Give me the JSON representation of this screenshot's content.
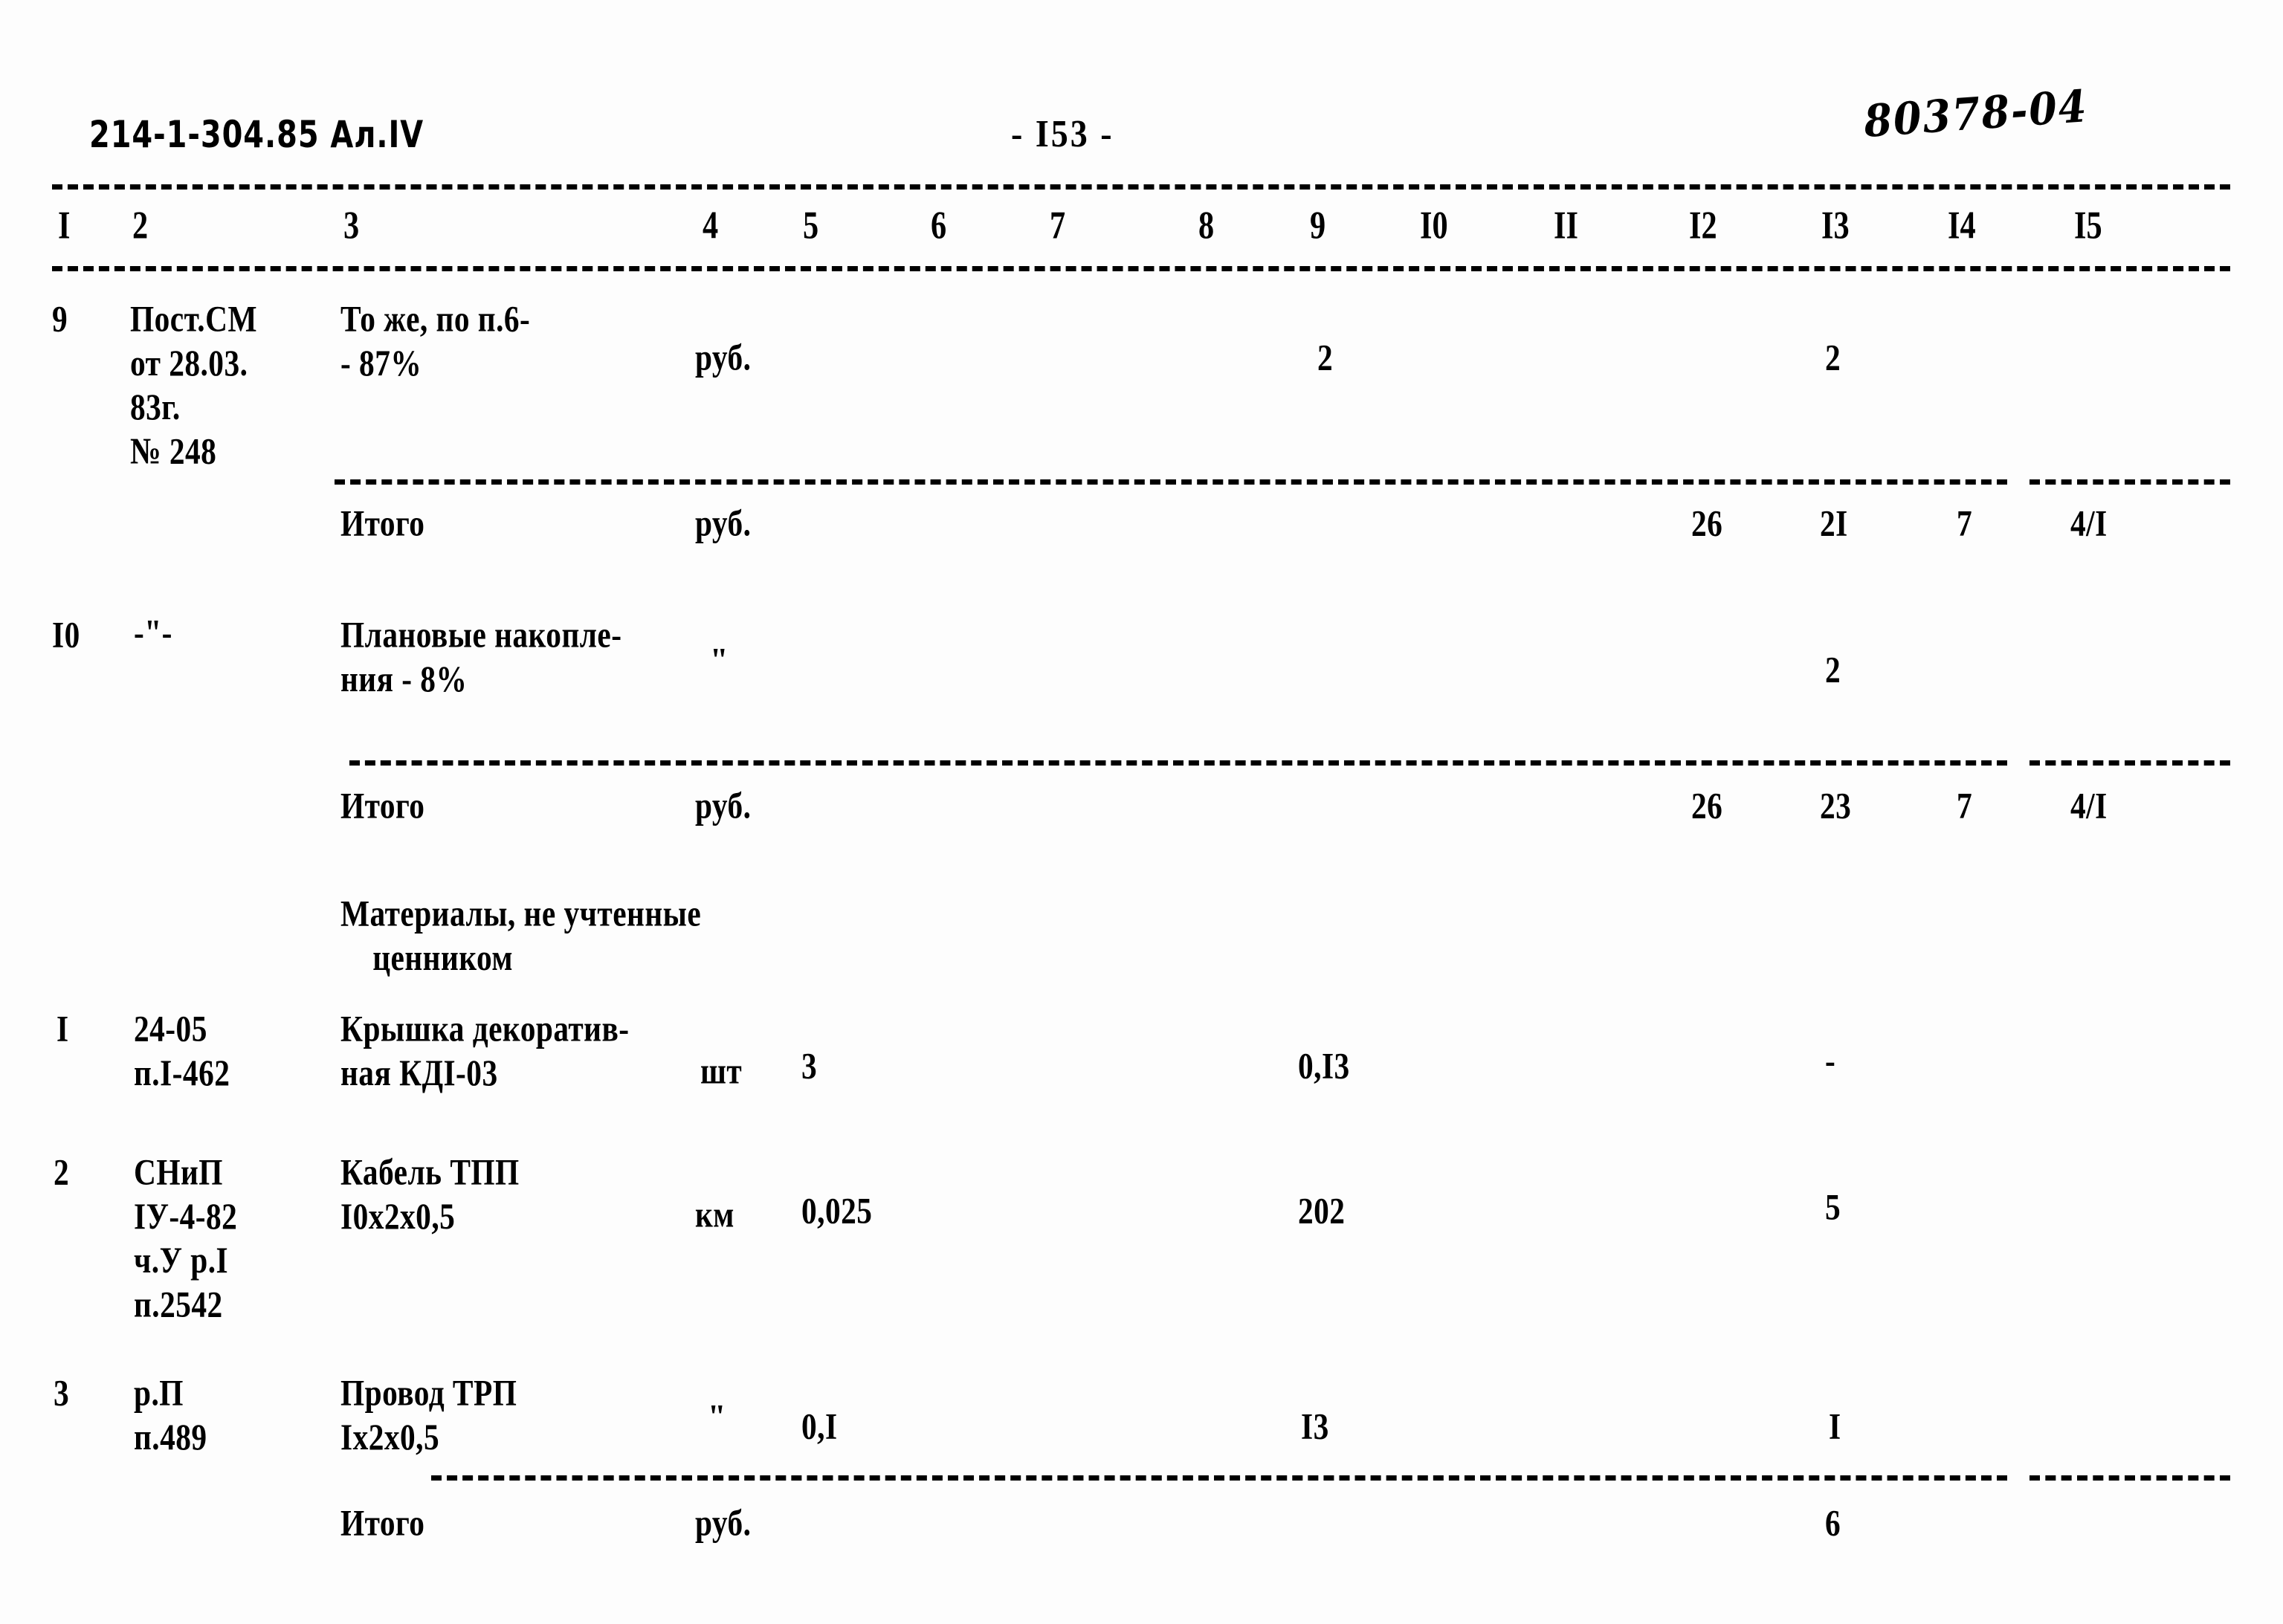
{
  "header": {
    "doc_code": "214-1-304.85  Ал.IV",
    "page_number": "- I53 -",
    "stamp": "80378-04"
  },
  "table": {
    "column_headers": [
      "I",
      "2",
      "3",
      "4",
      "5",
      "6",
      "7",
      "8",
      "9",
      "I0",
      "II",
      "I2",
      "I3",
      "I4",
      "I5"
    ],
    "rows": [
      {
        "kind": "item",
        "c1": "9",
        "c2": "Пост.СМ\nот 28.03.\n83г.\n№ 248",
        "c3": "То же, по п.6-\n- 87%",
        "c4": "руб.",
        "c5": "",
        "c9": "2",
        "c13": "2"
      },
      {
        "kind": "total",
        "c3": "Итого",
        "c4": "руб.",
        "c12": "26",
        "c13": "2I",
        "c14": "7",
        "c15": "4/I"
      },
      {
        "kind": "item",
        "c1": "I0",
        "c2": "-\"-",
        "c3": "Плановые накопле-\nния - 8%",
        "c4": "\"",
        "c13": "2"
      },
      {
        "kind": "total",
        "c3": "Итого",
        "c4": "руб.",
        "c12": "26",
        "c13": "23",
        "c14": "7",
        "c15": "4/I"
      },
      {
        "kind": "section",
        "c3": "Материалы, не учтенные\n    ценником"
      },
      {
        "kind": "item",
        "c1": "I",
        "c2": "24-05\nп.I-462",
        "c3": "Крышка декоратив-\nная КДI-03",
        "c4": "шт",
        "c5": "3",
        "c9": "0,I3",
        "c13": "-"
      },
      {
        "kind": "item",
        "c1": "2",
        "c2": "СНиП\nIУ-4-82\nч.У р.I\nп.2542",
        "c3": "Кабель ТПП\nI0х2х0,5",
        "c4": "км",
        "c5": "0,025",
        "c9": "202",
        "c13": "5"
      },
      {
        "kind": "item",
        "c1": "3",
        "c2": "р.П\nп.489",
        "c3": "Провод ТРП\nIх2х0,5",
        "c4": "\"",
        "c5": "0,I",
        "c9": "I3",
        "c13": "I"
      },
      {
        "kind": "total",
        "c3": "Итого",
        "c4": "руб.",
        "c13": "6"
      }
    ]
  }
}
